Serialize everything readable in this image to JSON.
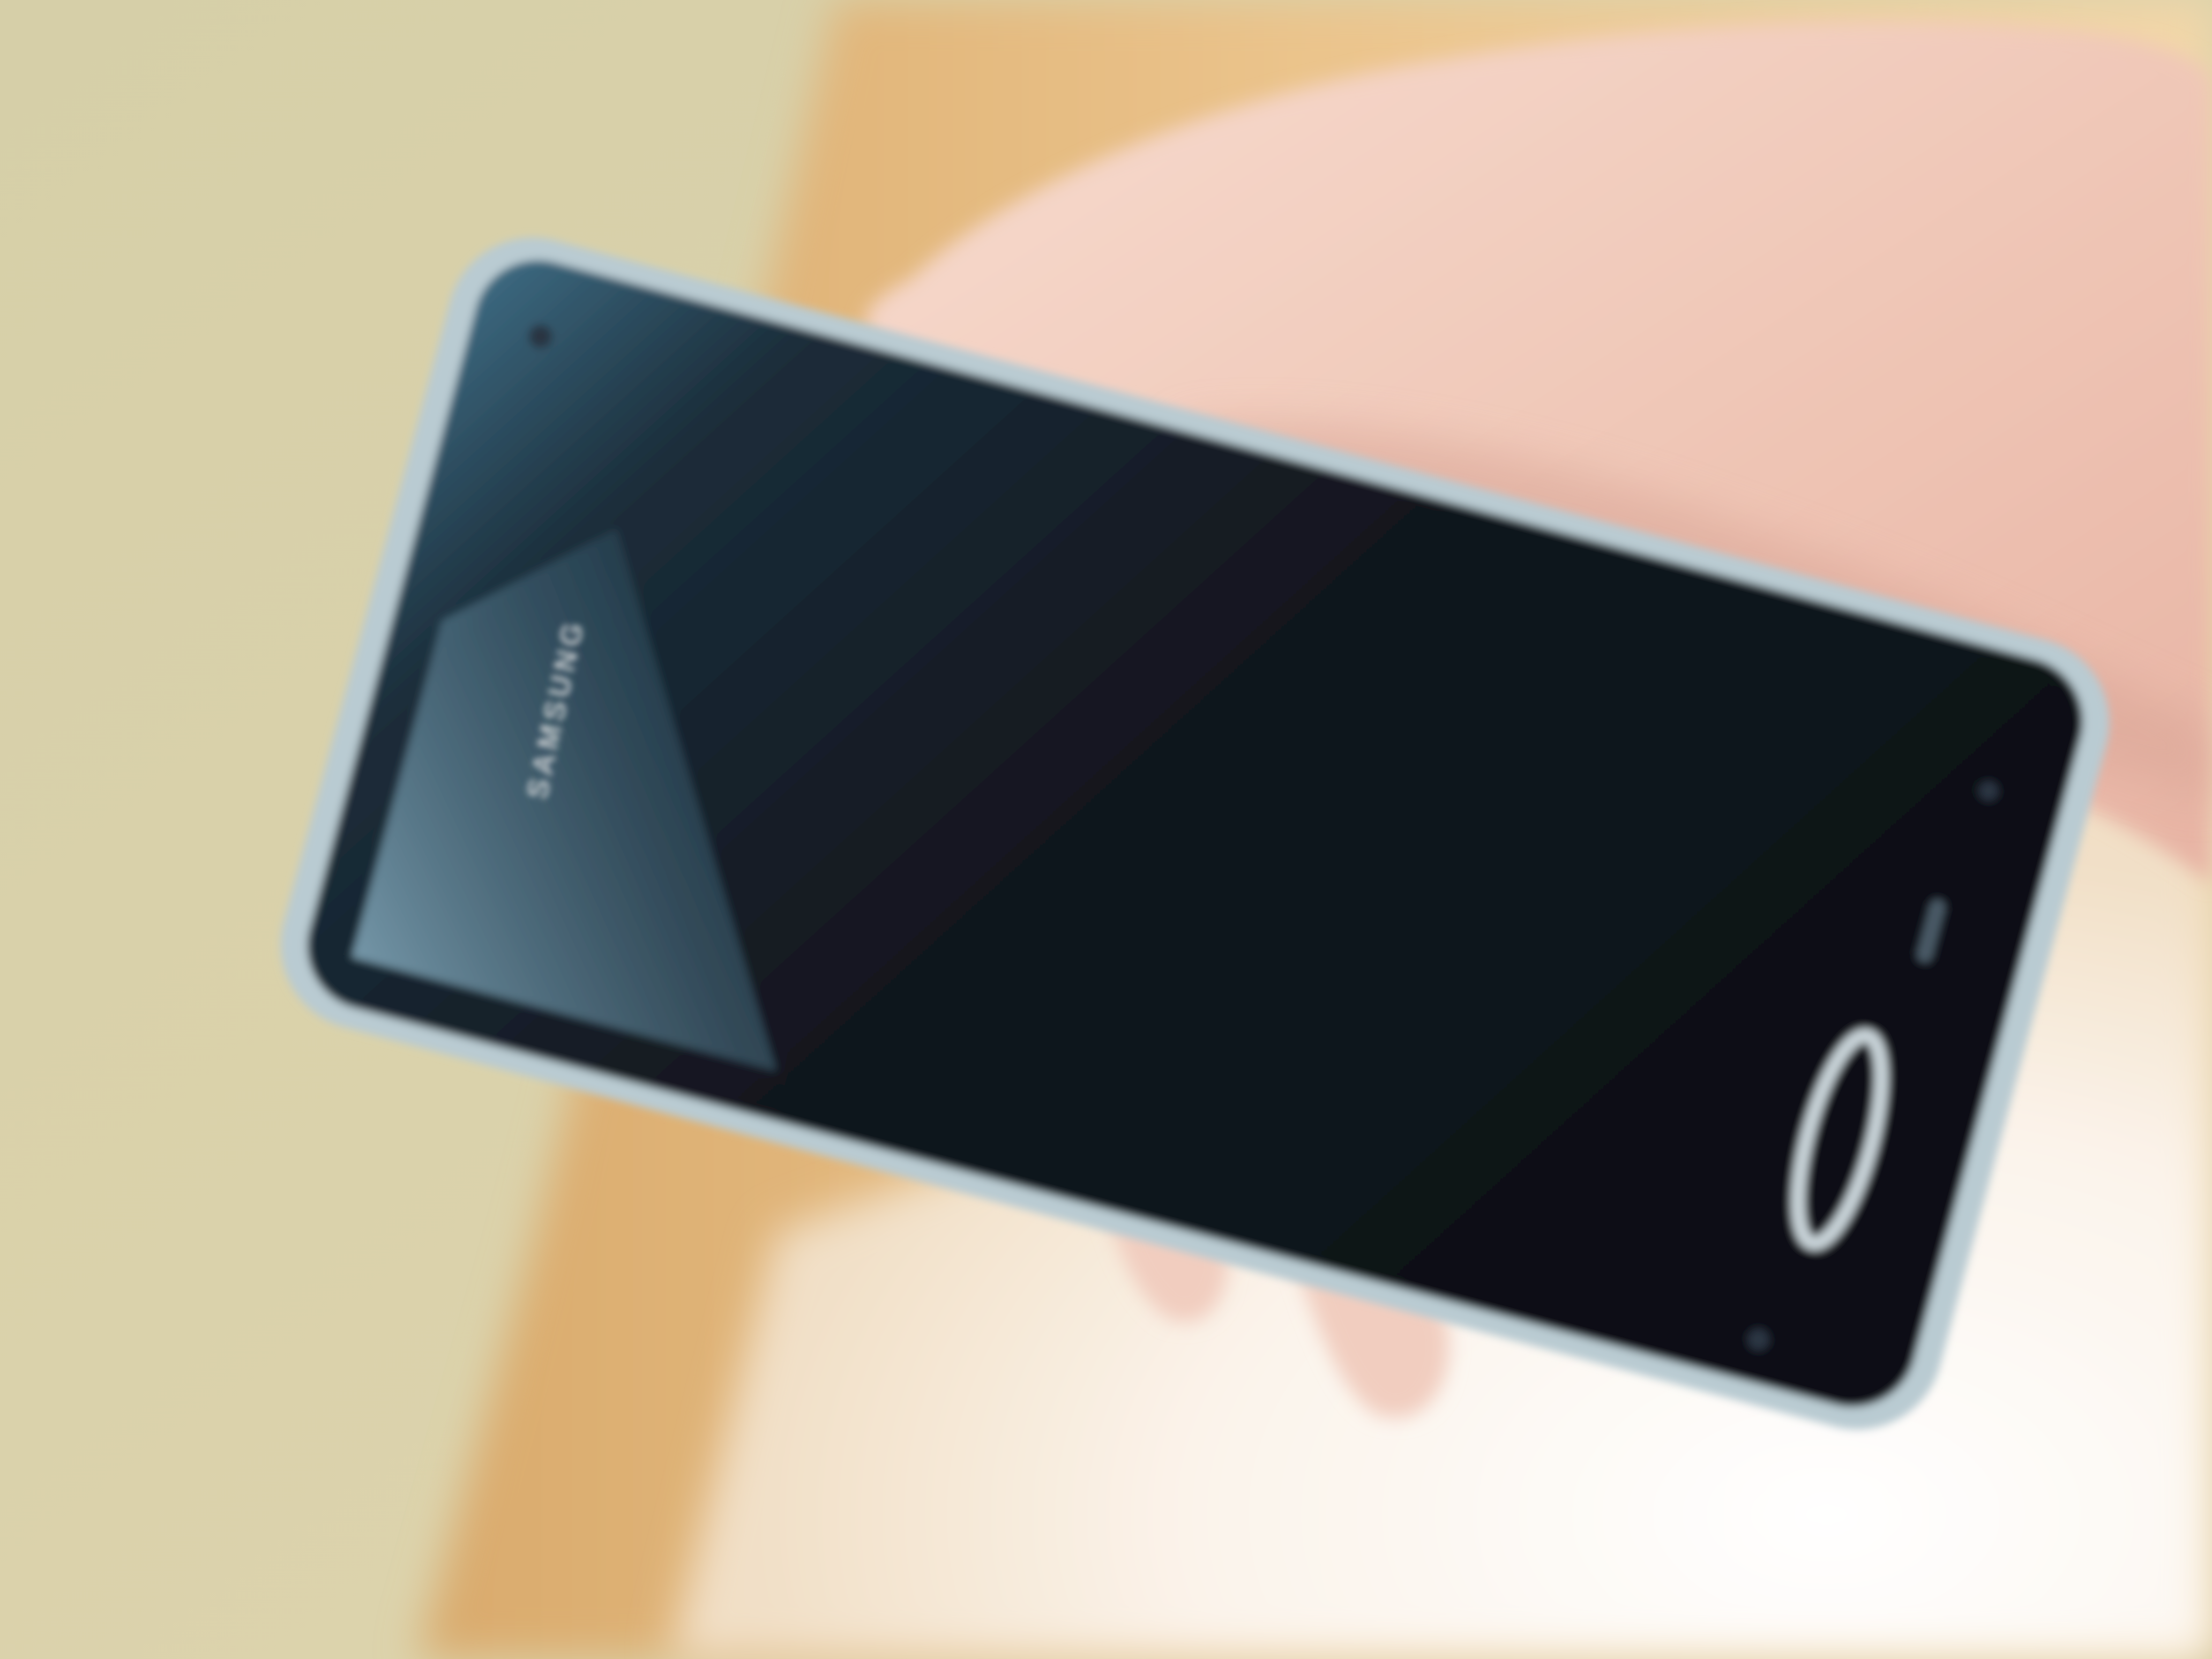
{
  "scene": {
    "description_tag": "",
    "colors": {
      "wall": "#d8cfa6",
      "wood_surface": "#e6bc82",
      "bright_area": "#fbf4ec",
      "skin": "#f2cdbf",
      "skin_shadow": "#d9a596",
      "phone_bezel": "#b9cbd2",
      "phone_screen": "#10141b",
      "screen_reflection": "#5a7f95"
    }
  },
  "phone": {
    "brand_text": "SAMSUNG",
    "screen_state": "off",
    "icons": [
      "front-camera-icon",
      "proximity-sensor-icon",
      "earpiece-icon",
      "home-button-icon"
    ]
  }
}
